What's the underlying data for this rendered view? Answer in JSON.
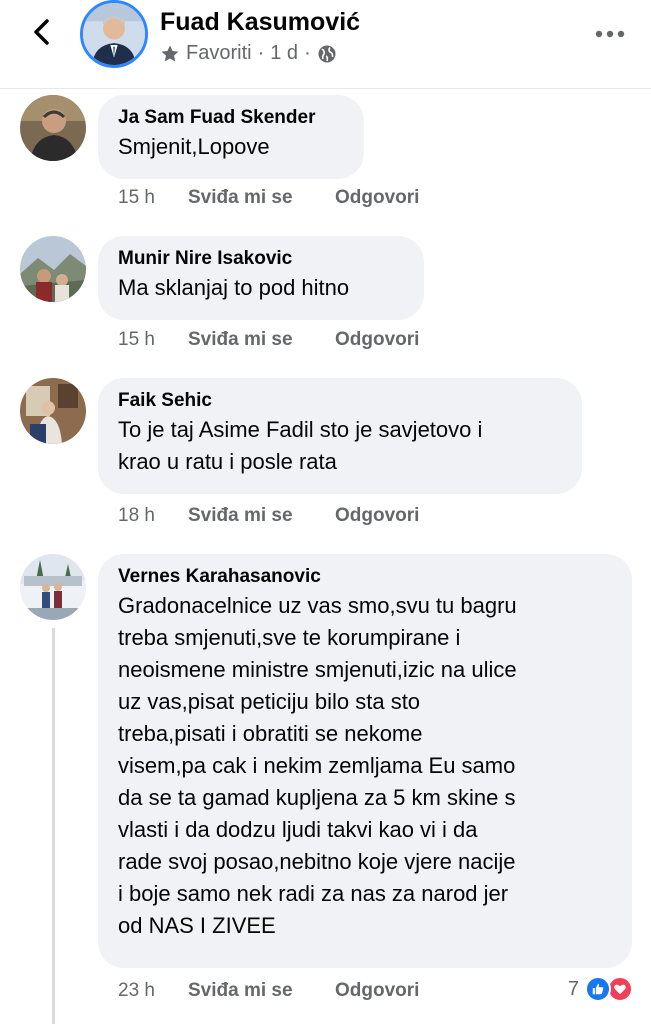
{
  "header": {
    "page_name": "Fuad Kasumović",
    "audience_label": "Favoriti",
    "separator": "·",
    "age": "1 d",
    "icons": {
      "back": "chevron-left-icon",
      "star": "star-icon",
      "globe": "globe-icon",
      "more": "more-dots-icon"
    }
  },
  "actions": {
    "like_label": "Sviđa mi se",
    "reply_label": "Odgovori"
  },
  "comments": [
    {
      "author": "Ja Sam Fuad Skender",
      "text": "Smjenit,Lopove",
      "time": "15 h"
    },
    {
      "author": "Munir Nire Isakovic",
      "text": "Ma sklanjaj to pod hitno",
      "time": "15 h"
    },
    {
      "author": "Faik Sehic",
      "text": "To je taj Asime Fadil sto je savjetovo i\nkrao u ratu i posle rata",
      "time": "18 h"
    },
    {
      "author": "Vernes Karahasanovic",
      "text": "Gradonacelnice uz vas smo,svu tu bagru\ntreba smjenuti,sve te korumpirane i\nneoismene ministre smjenuti,izic na ulice\nuz vas,pisat peticiju bilo sta sto\ntreba,pisati i obratiti se nekome\nvisem,pa cak i nekim zemljama Eu samo\nda se ta gamad kupljena za 5 km  skine s\nvlasti i da dodzu ljudi takvi kao vi i da\nrade svoj posao,nebitno koje vjere nacije\ni boje samo nek radi za nas za narod jer\nod NAS I ZIVEE",
      "time": "23 h",
      "reaction_count": "7"
    }
  ],
  "colors": {
    "accent": "#1877f2",
    "love": "#f33e58",
    "bubble": "#f0f2f5",
    "secondary_text": "#65676b"
  }
}
